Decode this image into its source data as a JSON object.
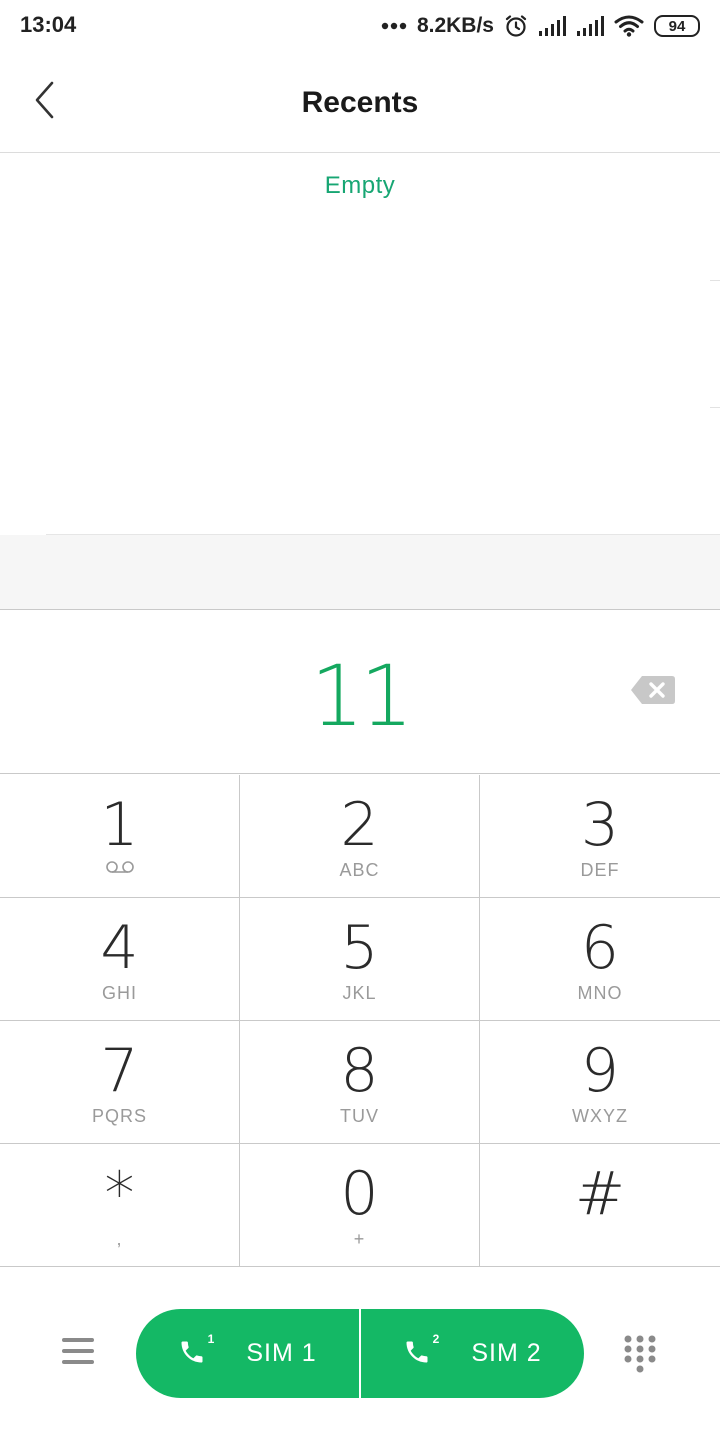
{
  "status_bar": {
    "time": "13:04",
    "speed": "8.2KB/s",
    "battery": "94",
    "icons": [
      "more-dots-icon",
      "alarm-icon",
      "signal-icon",
      "signal-icon",
      "wifi-icon",
      "battery-icon"
    ]
  },
  "header": {
    "title": "Recents",
    "back_icon": "chevron-left-icon"
  },
  "recents": {
    "empty_text": "Empty"
  },
  "dialer": {
    "number": "11",
    "backspace_icon": "backspace-icon"
  },
  "keypad": {
    "keys": [
      {
        "digit": "1",
        "letters": "",
        "sub_icon": "voicemail-icon"
      },
      {
        "digit": "2",
        "letters": "ABC"
      },
      {
        "digit": "3",
        "letters": "DEF"
      },
      {
        "digit": "4",
        "letters": "GHI"
      },
      {
        "digit": "5",
        "letters": "JKL"
      },
      {
        "digit": "6",
        "letters": "MNO"
      },
      {
        "digit": "7",
        "letters": "PQRS"
      },
      {
        "digit": "8",
        "letters": "TUV"
      },
      {
        "digit": "9",
        "letters": "WXYZ"
      },
      {
        "digit": "*",
        "letters": ","
      },
      {
        "digit": "0",
        "letters": "+"
      },
      {
        "digit": "#",
        "letters": ""
      }
    ]
  },
  "bottom_bar": {
    "menu_icon": "hamburger-menu-icon",
    "sim1_label": "SIM 1",
    "sim1_badge": "1",
    "sim2_label": "SIM 2",
    "sim2_badge": "2",
    "dialpad_icon": "dialpad-icon"
  },
  "colors": {
    "accent_green": "#14b865",
    "number_green": "#14a85f",
    "empty_green": "#17a673"
  }
}
